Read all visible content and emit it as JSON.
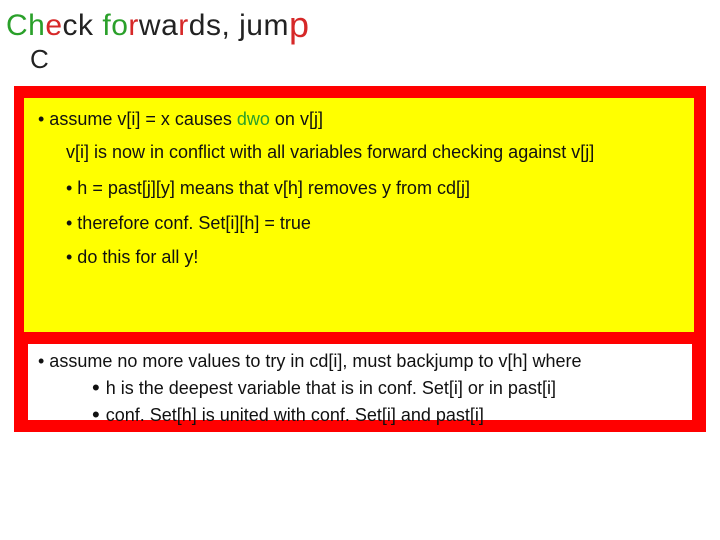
{
  "title": {
    "frag1": "Ch",
    "frag2": "e",
    "frag3": "ck",
    "frag4": " fo",
    "frag5": "r",
    "frag6": "wa",
    "frag7": "r",
    "frag8": "ds, jum",
    "frag9": "p"
  },
  "sub_c": "C",
  "yellow": {
    "line1_pre": "• assume v[i]  = x causes ",
    "line1_green": "dwo",
    "line1_post": " on v[j]",
    "indent1": "v[i] is now in conflict with all variables forward checking against v[j]",
    "bul1": "•  h = past[j][y]  means that v[h] removes y from cd[j]",
    "bul2": "• therefore conf. Set[i][h] = true",
    "bul3": "• do this for all y!"
  },
  "white": {
    "line1": "• assume no more values to try in cd[i], must backjump to v[h] where",
    "sub1": "h is the deepest variable that is in conf. Set[i] or in past[i]",
    "sub2": "conf. Set[h] is united with conf. Set[i] and past[i]"
  }
}
